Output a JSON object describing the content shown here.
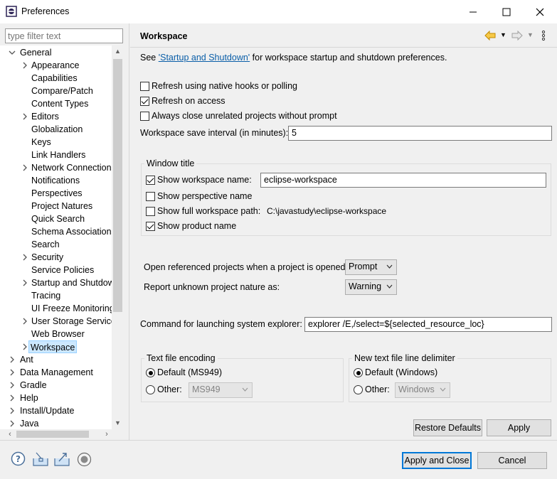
{
  "window": {
    "title": "Preferences",
    "minimize": "—",
    "maximize": "☐",
    "close": "✕"
  },
  "filter": {
    "placeholder": "type filter text"
  },
  "tree": {
    "general": "General",
    "general_children": [
      "Appearance",
      "Capabilities",
      "Compare/Patch",
      "Content Types",
      "Editors",
      "Globalization",
      "Keys",
      "Link Handlers",
      "Network Connections",
      "Notifications",
      "Perspectives",
      "Project Natures",
      "Quick Search",
      "Schema Associations",
      "Search",
      "Security",
      "Service Policies",
      "Startup and Shutdown",
      "Tracing",
      "UI Freeze Monitoring",
      "User Storage Service",
      "Web Browser",
      "Workspace"
    ],
    "top_level": [
      "Ant",
      "Data Management",
      "Gradle",
      "Help",
      "Install/Update",
      "Java"
    ]
  },
  "page": {
    "title": "Workspace",
    "see_prefix": "See ",
    "see_link": "'Startup and Shutdown'",
    "see_suffix": " for workspace startup and shutdown preferences.",
    "refresh_native": "Refresh using native hooks or polling",
    "refresh_access": "Refresh on access",
    "always_close": "Always close unrelated projects without prompt",
    "save_interval_label": "Workspace save interval (in minutes):",
    "save_interval_value": "5",
    "window_title_group": "Window title",
    "show_ws_name": "Show workspace name:",
    "ws_name_value": "eclipse-workspace",
    "show_perspective": "Show perspective name",
    "show_full_path": "Show full workspace path:",
    "full_path_value": "C:\\javastudy\\eclipse-workspace",
    "show_product": "Show product name",
    "open_ref_label": "Open referenced projects when a project is opened:",
    "open_ref_value": "Prompt",
    "report_unknown_label": "Report unknown project nature as:",
    "report_unknown_value": "Warning",
    "command_label": "Command for launching system explorer:",
    "command_value": "explorer /E,/select=${selected_resource_loc}",
    "encoding_group": "Text file encoding",
    "enc_default": "Default (MS949)",
    "enc_other": "Other:",
    "enc_other_value": "MS949",
    "delim_group": "New text file line delimiter",
    "delim_default": "Default (Windows)",
    "delim_other": "Other:",
    "delim_other_value": "Windows"
  },
  "buttons": {
    "restore": "Restore Defaults",
    "apply": "Apply",
    "apply_close": "Apply and Close",
    "cancel": "Cancel"
  },
  "colors": {
    "accent": "#0078d7",
    "link": "#0a5ea8",
    "selection": "#cce8ff"
  }
}
